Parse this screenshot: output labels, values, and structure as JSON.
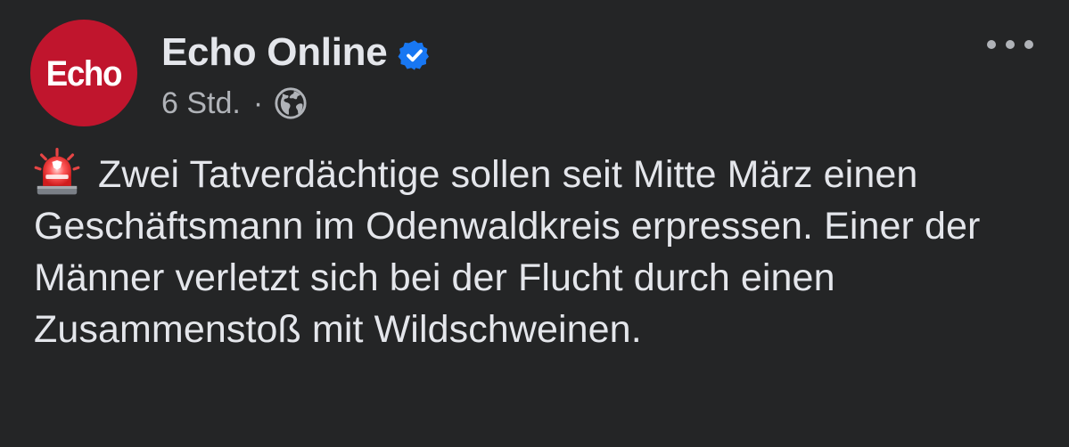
{
  "post": {
    "avatar_text": "Echo",
    "page_name": "Echo Online",
    "timestamp": "6 Std.",
    "separator": "·",
    "audience_icon": "globe-icon",
    "verified_icon": "verified-badge-icon",
    "more_icon": "more-options-icon",
    "emoji_icon": "police-siren-emoji",
    "text": "Zwei Tatverdächtige sollen seit Mitte März einen Geschäftsmann im Odenwaldkreis erpressen. Einer der Männer verletzt sich bei der Flucht durch einen Zusammenstoß mit Wildschweinen."
  },
  "colors": {
    "background": "#242526",
    "primary_text": "#e4e6eb",
    "secondary_text": "#b0b3b8",
    "avatar_red": "#c0152d",
    "verified_blue": "#1877f2"
  }
}
